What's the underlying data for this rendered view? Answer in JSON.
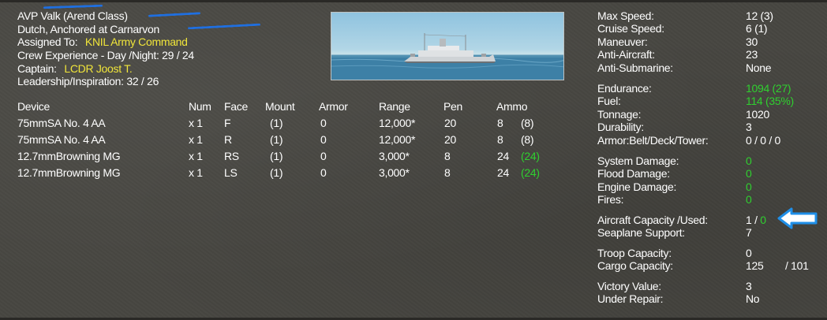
{
  "ship": {
    "name": "AVP Valk (Arend Class)",
    "status": "Dutch, Anchored at Carnarvon",
    "assigned_label": "Assigned To:",
    "assigned_value": "KNIL Army Command",
    "crew_experience": "Crew Experience - Day /Night:  29 / 24",
    "captain_label": "Captain:",
    "captain_value": "LCDR Joost T.",
    "leadership": "Leadership/Inspiration:  32 / 26"
  },
  "weapons": {
    "headers": [
      "Device",
      "Num",
      "Face",
      "Mount",
      "Armor",
      "Range",
      "Pen",
      "Ammo"
    ],
    "rows": [
      {
        "device": "75mmSA No. 4 AA",
        "num": "x 1",
        "face": "F",
        "mount": "(1)",
        "armor": "0",
        "range": "12,000*",
        "pen": "20",
        "ammo": "8",
        "ammo_reserve": "(8)",
        "reserve_green": false
      },
      {
        "device": "75mmSA No. 4 AA",
        "num": "x 1",
        "face": "R",
        "mount": "(1)",
        "armor": "0",
        "range": "12,000*",
        "pen": "20",
        "ammo": "8",
        "ammo_reserve": "(8)",
        "reserve_green": false
      },
      {
        "device": "12.7mmBrowning MG",
        "num": "x 1",
        "face": "RS",
        "mount": "(1)",
        "armor": "0",
        "range": "3,000*",
        "pen": "8",
        "ammo": "24",
        "ammo_reserve": "(24)",
        "reserve_green": true
      },
      {
        "device": "12.7mmBrowning MG",
        "num": "x 1",
        "face": "LS",
        "mount": "(1)",
        "armor": "0",
        "range": "3,000*",
        "pen": "8",
        "ammo": "24",
        "ammo_reserve": "(24)",
        "reserve_green": true
      }
    ]
  },
  "stats": {
    "max_speed": {
      "label": "Max Speed:",
      "value": "12 (3)"
    },
    "cruise_speed": {
      "label": "Cruise Speed:",
      "value": "6 (1)"
    },
    "maneuver": {
      "label": "Maneuver:",
      "value": "30"
    },
    "anti_aircraft": {
      "label": "Anti-Aircraft:",
      "value": "23"
    },
    "anti_submarine": {
      "label": "Anti-Submarine:",
      "value": "None"
    },
    "endurance": {
      "label": "Endurance:",
      "value": "1094  (27)"
    },
    "fuel": {
      "label": "Fuel:",
      "value": "114  (35%)"
    },
    "tonnage": {
      "label": "Tonnage:",
      "value": "1020"
    },
    "durability": {
      "label": "Durability:",
      "value": "3"
    },
    "armor": {
      "label": "Armor:Belt/Deck/Tower:",
      "value": "0 / 0 / 0"
    },
    "system_damage": {
      "label": "System Damage:",
      "value": "0"
    },
    "flood_damage": {
      "label": "Flood Damage:",
      "value": "0"
    },
    "engine_damage": {
      "label": "Engine Damage:",
      "value": "0"
    },
    "fires": {
      "label": "Fires:",
      "value": "0"
    },
    "aircraft_capacity": {
      "label": "Aircraft Capacity /Used:",
      "value_cap": "1",
      "sep": " / ",
      "value_used": "0"
    },
    "seaplane_support": {
      "label": "Seaplane Support:",
      "value": "7"
    },
    "troop_capacity": {
      "label": "Troop Capacity:",
      "value": "0"
    },
    "cargo_capacity": {
      "label": "Cargo Capacity:",
      "value": "125",
      "value2": "/ 101"
    },
    "victory_value": {
      "label": "Victory Value:",
      "value": "3"
    },
    "under_repair": {
      "label": "Under Repair:",
      "value": "No"
    }
  },
  "colors": {
    "background": "#474641",
    "highlight_yellow": "#f0e53a",
    "highlight_green": "#2fd02f",
    "annotation_blue": "#1f8fe8"
  },
  "icons": {
    "ship_picture": "ship-silhouette",
    "annotation_arrow": "left-arrow-icon"
  }
}
